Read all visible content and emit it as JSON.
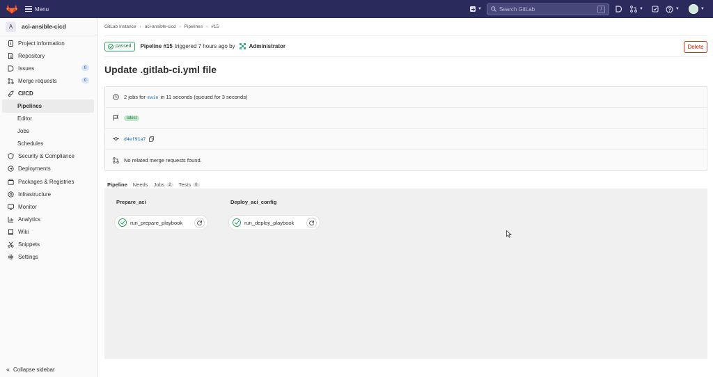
{
  "topbar": {
    "menu_label": "Menu",
    "search_placeholder": "Search GitLab",
    "search_shortcut": "/"
  },
  "sidebar": {
    "project_initial": "A",
    "project_name": "aci-ansible-cicd",
    "items": [
      {
        "label": "Project information",
        "icon": "info-icon"
      },
      {
        "label": "Repository",
        "icon": "doc-icon"
      },
      {
        "label": "Issues",
        "icon": "issues-icon",
        "badge": "0"
      },
      {
        "label": "Merge requests",
        "icon": "merge-icon",
        "badge": "0"
      },
      {
        "label": "CI/CD",
        "icon": "rocket-icon"
      },
      {
        "label": "Pipelines"
      },
      {
        "label": "Editor"
      },
      {
        "label": "Jobs"
      },
      {
        "label": "Schedules"
      },
      {
        "label": "Security & Compliance",
        "icon": "shield-icon"
      },
      {
        "label": "Deployments",
        "icon": "deploy-icon"
      },
      {
        "label": "Packages & Registries",
        "icon": "package-icon"
      },
      {
        "label": "Infrastructure",
        "icon": "cloud-icon"
      },
      {
        "label": "Monitor",
        "icon": "monitor-icon"
      },
      {
        "label": "Analytics",
        "icon": "chart-icon"
      },
      {
        "label": "Wiki",
        "icon": "book-icon"
      },
      {
        "label": "Snippets",
        "icon": "scissors-icon"
      },
      {
        "label": "Settings",
        "icon": "gear-icon"
      }
    ],
    "collapse_label": "Collapse sidebar"
  },
  "breadcrumb": [
    "GitLab Instance",
    "aci-ansible-cicd",
    "Pipelines",
    "#15"
  ],
  "header": {
    "status": "passed",
    "pipeline": "Pipeline #15",
    "triggered": "triggered 7 hours ago by",
    "user": "Administrator",
    "delete_label": "Delete"
  },
  "title": "Update .gitlab-ci.yml file",
  "info": {
    "jobs_prefix": "2 jobs for",
    "branch": "main",
    "jobs_suffix": "in 11 seconds (queued for 3 seconds)",
    "tag": "latest",
    "sha": "d4ef91a7",
    "mr_text": "No related merge requests found."
  },
  "tabs": [
    {
      "label": "Pipeline"
    },
    {
      "label": "Needs"
    },
    {
      "label": "Jobs",
      "count": "2"
    },
    {
      "label": "Tests",
      "count": "0"
    }
  ],
  "stages": [
    {
      "name": "Prepare_aci",
      "job": "run_prepare_playbook"
    },
    {
      "name": "Deploy_aci_config",
      "job": "run_deploy_playbook"
    }
  ],
  "colors": {
    "topbar": "#2b2a5c",
    "success": "#2da160",
    "danger": "#dd2b0e",
    "link": "#1068bf"
  }
}
